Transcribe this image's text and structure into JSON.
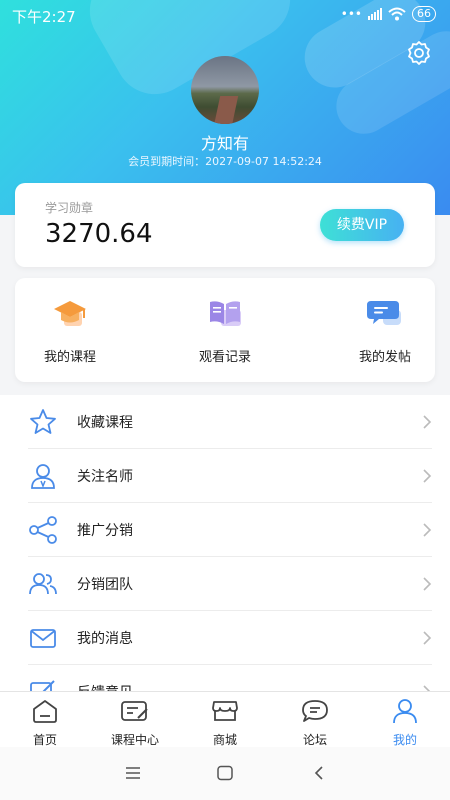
{
  "status_bar": {
    "time": "下午2:27",
    "battery": "66"
  },
  "profile": {
    "name": "方知有",
    "expire_label": "会员到期时间：2027-09-07 14:52:24"
  },
  "medal": {
    "label": "学习勋章",
    "value": "3270.64",
    "vip_button": "续费VIP"
  },
  "quick_actions": [
    {
      "label": "我的课程",
      "icon": "graduation-cap-icon"
    },
    {
      "label": "观看记录",
      "icon": "open-book-icon"
    },
    {
      "label": "我的发帖",
      "icon": "chat-bubble-icon"
    }
  ],
  "menu": [
    {
      "label": "收藏课程",
      "icon": "star-icon"
    },
    {
      "label": "关注名师",
      "icon": "person-icon"
    },
    {
      "label": "推广分销",
      "icon": "share-icon"
    },
    {
      "label": "分销团队",
      "icon": "team-icon"
    },
    {
      "label": "我的消息",
      "icon": "mail-icon"
    },
    {
      "label": "反馈意见",
      "icon": "edit-icon"
    }
  ],
  "tabs": [
    {
      "label": "首页",
      "icon": "home-icon"
    },
    {
      "label": "课程中心",
      "icon": "course-icon"
    },
    {
      "label": "商城",
      "icon": "shop-icon"
    },
    {
      "label": "论坛",
      "icon": "forum-icon"
    },
    {
      "label": "我的",
      "icon": "profile-icon",
      "active": true
    }
  ],
  "colors": {
    "accent": "#3a8bf0",
    "gradient_start": "#2fe0dd",
    "icon_blue": "#4a8be8"
  }
}
